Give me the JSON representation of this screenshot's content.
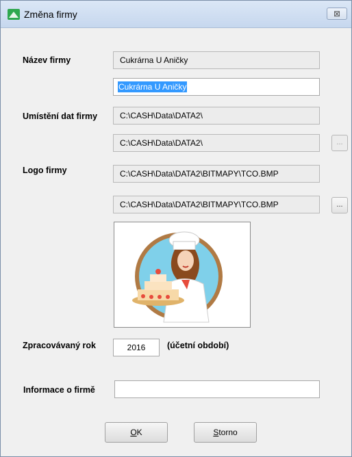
{
  "window": {
    "title": "Změna firmy",
    "close_glyph": "⊠"
  },
  "form": {
    "company_name_label": "Název firmy",
    "company_name_current": "Cukrárna U Aničky",
    "company_name_input": "Cukrárna U Aničky",
    "data_location_label": "Umístění dat firmy",
    "data_location_current": "C:\\CASH\\Data\\DATA2\\",
    "data_location_input": "C:\\CASH\\Data\\DATA2\\",
    "browse_label": "...",
    "logo_label": "Logo firmy",
    "logo_current": "C:\\CASH\\Data\\DATA2\\BITMAPY\\TCO.BMP",
    "logo_input": "C:\\CASH\\Data\\DATA2\\BITMAPY\\TCO.BMP",
    "logo_image_icon": "pastry-chef-logo",
    "year_label": "Zpracovávaný rok",
    "year_value": "2016",
    "year_note": "(účetní období)",
    "info_label": "Informace o firmě",
    "info_value": ""
  },
  "buttons": {
    "ok_accel": "O",
    "ok_rest": "K",
    "cancel_accel": "S",
    "cancel_rest": "torno"
  },
  "colors": {
    "selection": "#3399ff",
    "title_bar": "#c6d7ee",
    "dialog_bg": "#f0f0f0"
  }
}
